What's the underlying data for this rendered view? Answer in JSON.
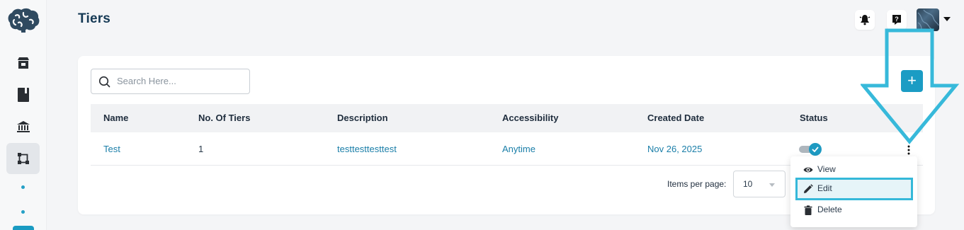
{
  "page": {
    "title": "Tiers"
  },
  "sidebar": {
    "items": [
      {
        "icon": "store-icon"
      },
      {
        "icon": "book-icon"
      },
      {
        "icon": "bank-icon"
      },
      {
        "icon": "tiers-icon",
        "active": true
      }
    ]
  },
  "header": {
    "notification_icon": "bell-icon",
    "help_icon": "help-icon"
  },
  "search": {
    "placeholder": "Search Here..."
  },
  "add_button": {
    "label": "+"
  },
  "table": {
    "columns": [
      "Name",
      "No. Of Tiers",
      "Description",
      "Accessibility",
      "Created Date",
      "Status"
    ],
    "rows": [
      {
        "name": "Test",
        "tiers": "1",
        "description": "testtesttesttest",
        "accessibility": "Anytime",
        "created": "Nov 26, 2025",
        "status_enabled": true
      }
    ]
  },
  "pagination": {
    "label": "Items per page:",
    "value": "10"
  },
  "row_menu": {
    "items": [
      {
        "label": "View",
        "icon": "eye-icon"
      },
      {
        "label": "Edit",
        "icon": "pencil-icon"
      },
      {
        "label": "Delete",
        "icon": "trash-icon"
      }
    ]
  },
  "colors": {
    "accent": "#1b9cc4",
    "title": "#163a55",
    "highlight": "#35b8d9"
  }
}
